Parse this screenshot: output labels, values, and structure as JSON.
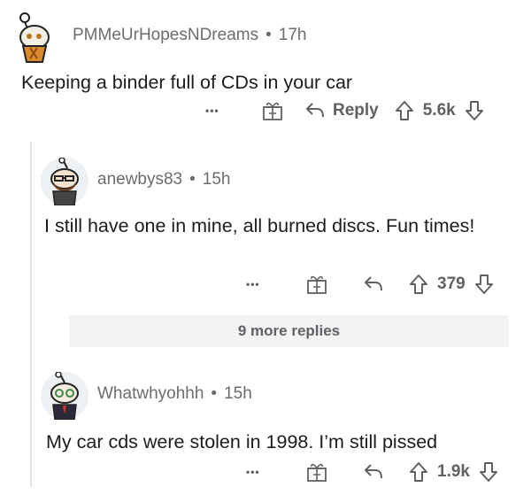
{
  "comments": [
    {
      "username": "PMMeUrHopesNDreams",
      "sep": "•",
      "time": "17h",
      "text": "Keeping a binder full of CDs in your car",
      "more": "•••",
      "reply_label": "Reply",
      "score": "5.6k"
    },
    {
      "username": "anewbys83",
      "sep": "•",
      "time": "15h",
      "text": "I still have one in mine, all burned discs. Fun times!",
      "more": "•••",
      "score": "379"
    },
    {
      "username": "Whatwhyohhh",
      "sep": "•",
      "time": "15h",
      "text": "My car cds were stolen in 1998. I’m still pissed",
      "more": "•••",
      "score": "1.9k"
    }
  ],
  "more_replies_label": "9 more replies",
  "colors": {
    "meta": "#6a6d70",
    "actions": "#5f6164",
    "thread_line": "#e6e7e8",
    "more_bg": "#f1f3f4"
  },
  "icons": [
    "more-dots-icon",
    "gift-award-icon",
    "reply-arrow-icon",
    "upvote-arrow-icon",
    "downvote-arrow-icon"
  ]
}
